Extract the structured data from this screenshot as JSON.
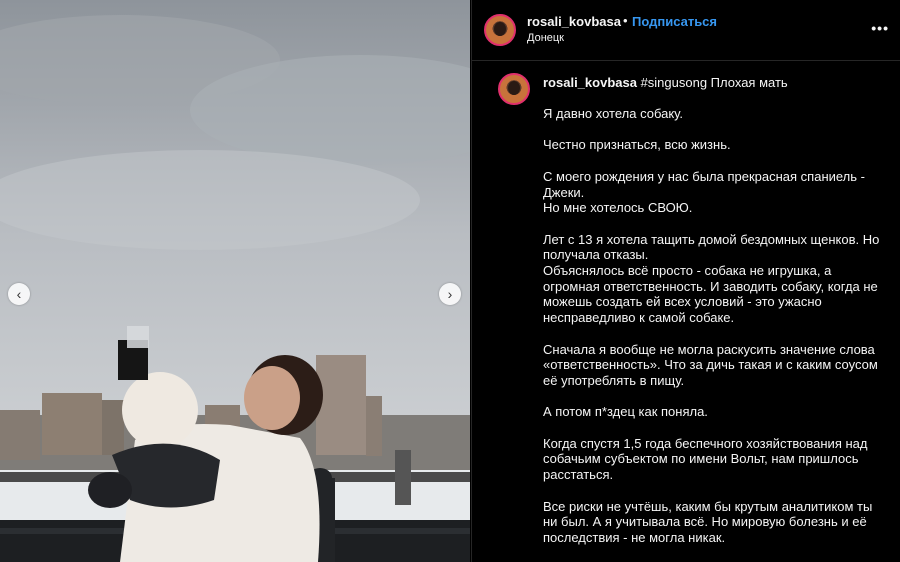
{
  "post": {
    "username": "rosali_kovbasa",
    "separator": "•",
    "follow_label": "Подписаться",
    "location": "Донецк",
    "more_label": "•••",
    "nav_prev": "‹",
    "nav_next": "›"
  },
  "caption": {
    "username": "rosali_kovbasa",
    "headline": " #singusong Плохая мать",
    "text": "Я давно хотела собаку.\n\nЧестно признаться, всю жизнь.\n\nС моего рождения у нас была прекрасная спаниель - Джеки.\nНо мне хотелось СВОЮ.\n\nЛет с 13 я хотела тащить домой бездомных щенков. Но получала отказы.\nОбъяснялось всё просто - собака не игрушка, а огромная ответственность. И заводить собаку, когда не можешь создать ей всех условий - это ужасно несправедливо к самой собаке.\n\nСначала я вообще не могла раскусить значение слова «ответственность». Что за дичь такая и с каким соусом её употреблять в пищу.\n\nА потом п*здец как поняла.\n\nКогда спустя 1,5 года беспечного хозяйствования над собачьим субъектом по имени Вольт, нам пришлось расстаться.\n\nВсе риски не учтёшь, каким бы крутым аналитиком ты ни был. А я учитывала всё. Но мировую болезнь и её последствия - не могла никак."
  },
  "colors": {
    "background": "#000000",
    "text": "#f5f5f5",
    "follow": "#3797f0",
    "divider": "#262626"
  }
}
